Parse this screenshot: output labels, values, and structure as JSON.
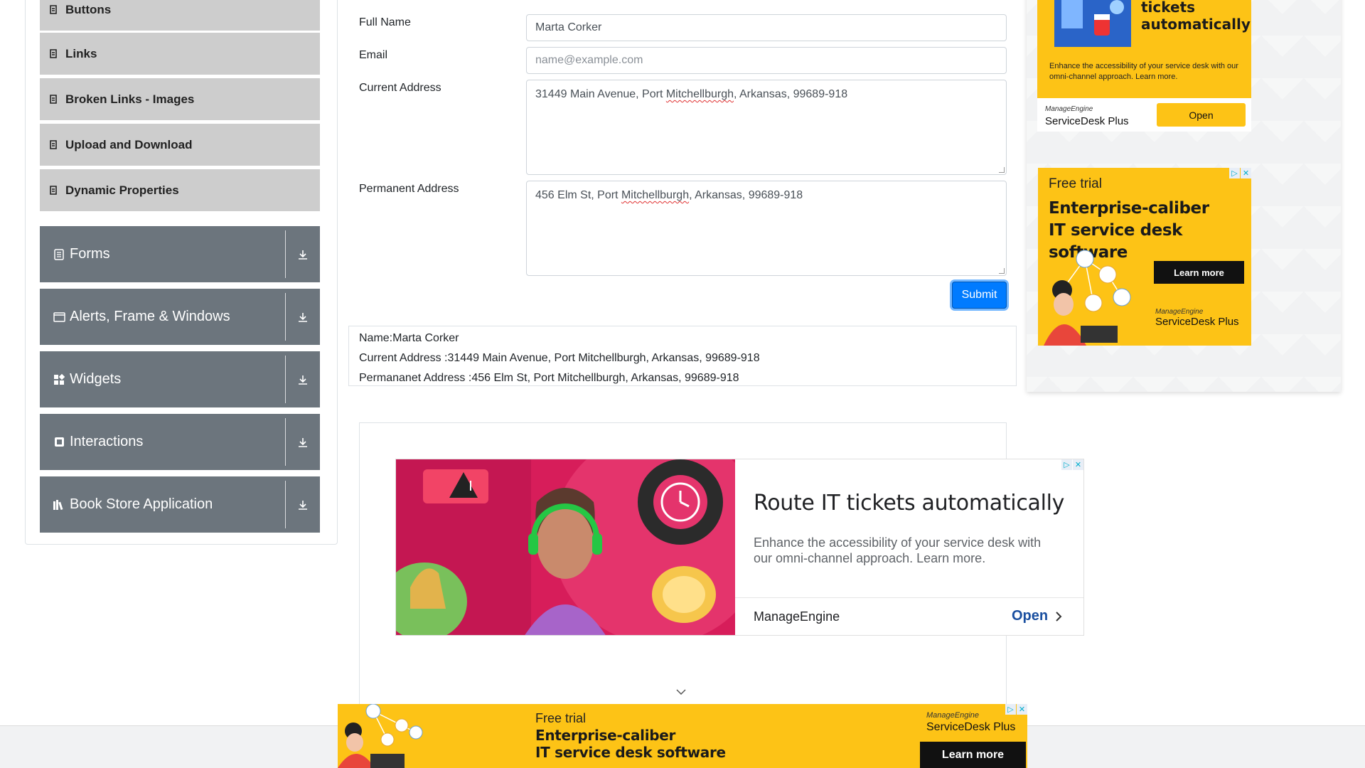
{
  "sidebar": {
    "sub_items": [
      {
        "label": "Buttons"
      },
      {
        "label": "Links"
      },
      {
        "label": "Broken Links - Images"
      },
      {
        "label": "Upload and Download"
      },
      {
        "label": "Dynamic Properties"
      }
    ],
    "groups": [
      {
        "label": "Forms",
        "icon": "form-icon"
      },
      {
        "label": "Alerts, Frame & Windows",
        "icon": "window-icon"
      },
      {
        "label": "Widgets",
        "icon": "widgets-icon"
      },
      {
        "label": "Interactions",
        "icon": "interactions-icon"
      },
      {
        "label": "Book Store Application",
        "icon": "books-icon"
      }
    ]
  },
  "form": {
    "full_name_label": "Full Name",
    "full_name_value": "Marta Corker",
    "email_label": "Email",
    "email_placeholder": "name@example.com",
    "current_address_label": "Current Address",
    "current_address": {
      "before": "31449 Main Avenue, Port ",
      "misspelled": "Mitchellburgh",
      "after": ", Arkansas, 99689-918"
    },
    "permanent_address_label": "Permanent Address",
    "permanent_address": {
      "before": "456 Elm St, Port ",
      "misspelled": "Mitchellburgh",
      "after": ", Arkansas, 99689-918"
    },
    "submit_label": "Submit"
  },
  "output": {
    "name": "Name:Marta Corker",
    "current_address": "Current Address :31449 Main Avenue, Port Mitchellburgh, Arkansas, 99689-918",
    "permanent_address": "Permananet Address :456 Elm St, Port Mitchellburgh, Arkansas, 99689-918"
  },
  "ads": {
    "center": {
      "headline": "Route IT tickets automatically",
      "description": "Enhance the accessibility of your service desk with our omni-channel approach. Learn more.",
      "brand": "ManageEngine",
      "open_label": "Open"
    },
    "right_top": {
      "title_line1": "tickets",
      "title_line2": "automatically",
      "body": "Enhance the accessibility of your service desk with our omni-channel approach. Learn more.",
      "logo_small": "ManageEngine",
      "product": "ServiceDesk Plus",
      "open_label": "Open"
    },
    "right_bottom": {
      "free_trial": "Free trial",
      "headline_line1": "Enterprise-caliber",
      "headline_line2": "IT service desk software",
      "cta": "Learn more",
      "logo_small": "ManageEngine",
      "product": "ServiceDesk Plus"
    },
    "bottom": {
      "free_trial": "Free trial",
      "headline_line1": "Enterprise-caliber",
      "headline_line2": "IT service desk software",
      "logo_small": "ManageEngine",
      "product": "ServiceDesk Plus",
      "cta": "Learn more"
    }
  },
  "colors": {
    "sidebar_sub_bg": "#cdcdcd",
    "sidebar_group_bg": "#6c757d",
    "primary": "#007bff",
    "ad_yellow": "#fdc316"
  }
}
